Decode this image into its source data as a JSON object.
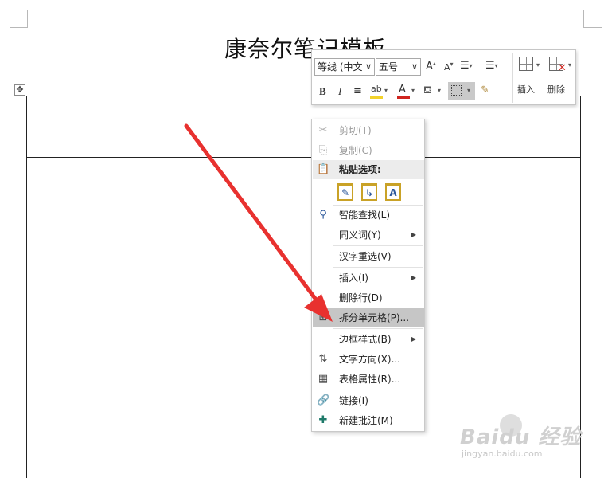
{
  "document": {
    "title": "康奈尔笔记模板",
    "table_move_handle": "✥"
  },
  "mini_toolbar": {
    "font_name": "等线 (中文",
    "font_size": "五号",
    "grow_font": "A",
    "shrink_font": "A",
    "bold": "B",
    "italic": "I",
    "font_color_letter": "A",
    "insert_label": "插入",
    "delete_label": "删除",
    "highlight_color": "#f2d22b",
    "font_color": "#d0251f"
  },
  "context_menu": {
    "items": [
      {
        "label": "剪切(T)",
        "icon": "scissors-icon"
      },
      {
        "label": "复制(C)",
        "icon": "copy-icon"
      },
      {
        "label": "粘贴选项:",
        "icon": "paste-icon"
      },
      {
        "label": "智能查找(L)",
        "icon": "smart-lookup-icon"
      },
      {
        "label": "同义词(Y)",
        "icon": ""
      },
      {
        "label": "汉字重选(V)",
        "icon": ""
      },
      {
        "label": "插入(I)",
        "icon": ""
      },
      {
        "label": "删除行(D)",
        "icon": ""
      },
      {
        "label": "拆分单元格(P)...",
        "icon": "split-cells-icon"
      },
      {
        "label": "边框样式(B)",
        "icon": ""
      },
      {
        "label": "文字方向(X)...",
        "icon": "text-direction-icon"
      },
      {
        "label": "表格属性(R)...",
        "icon": "table-properties-icon"
      },
      {
        "label": "链接(I)",
        "icon": "link-icon"
      },
      {
        "label": "新建批注(M)",
        "icon": "new-comment-icon"
      }
    ],
    "submenu_glyph": "▶"
  },
  "watermark": {
    "brand": "Baidu 经验",
    "url": "jingyan.baidu.com"
  },
  "annotation_color": "#e8312f"
}
